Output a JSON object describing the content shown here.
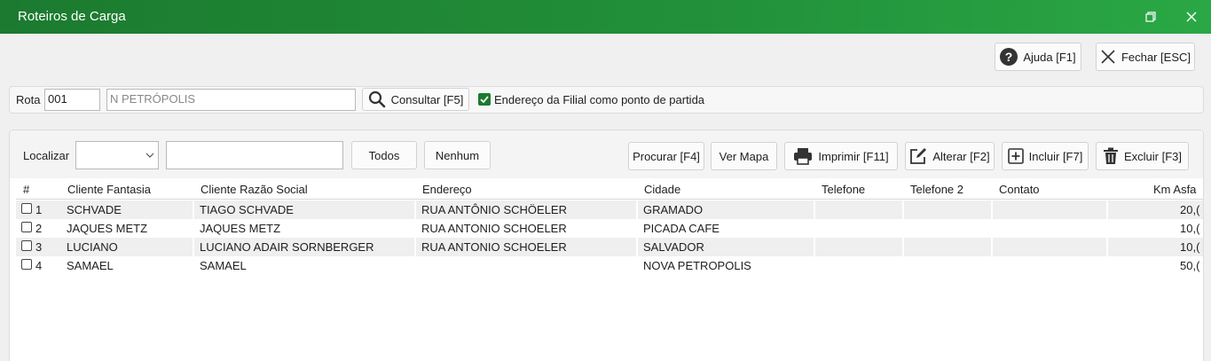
{
  "window": {
    "title": "Roteiros de Carga",
    "restore_icon": "restore-icon",
    "close_icon": "close-icon"
  },
  "topbar": {
    "help_label": "Ajuda [F1]",
    "close_label": "Fechar [ESC]"
  },
  "rota": {
    "label": "Rota",
    "code": "001",
    "name": "N PETRÓPOLIS",
    "consult_label": "Consultar [F5]",
    "filial_checked": true,
    "filial_label": "Endereço da Filial como ponto de partida"
  },
  "toolbar": {
    "locate_label": "Localizar",
    "locate_select_value": "",
    "locate_input_value": "",
    "all_label": "Todos",
    "none_label": "Nenhum",
    "search_label": "Procurar [F4]",
    "map_label": "Ver Mapa",
    "print_label": "Imprimir [F11]",
    "edit_label": "Alterar [F2]",
    "add_label": "Incluir [F7]",
    "delete_label": "Excluir [F3]"
  },
  "table": {
    "columns": [
      "#",
      "Cliente Fantasia",
      "Cliente Razão Social",
      "Endereço",
      "Cidade",
      "Telefone",
      "Telefone 2",
      "Contato",
      "Km Asfa"
    ],
    "rows": [
      {
        "num": "1",
        "fantasia": "SCHVADE",
        "razao": "TIAGO SCHVADE",
        "endereco": "RUA ANTÔNIO SCHÖELER",
        "cidade": "GRAMADO",
        "telefone": "",
        "telefone2": "",
        "contato": "",
        "km": "20,("
      },
      {
        "num": "2",
        "fantasia": "JAQUES METZ",
        "razao": "JAQUES METZ",
        "endereco": "RUA ANTONIO SCHOELER",
        "cidade": "PICADA CAFE",
        "telefone": "",
        "telefone2": "",
        "contato": "",
        "km": "10,("
      },
      {
        "num": "3",
        "fantasia": "LUCIANO",
        "razao": "LUCIANO ADAIR SORNBERGER",
        "endereco": "RUA ANTONIO SCHOELER",
        "cidade": "SALVADOR",
        "telefone": "",
        "telefone2": "",
        "contato": "",
        "km": "10,("
      },
      {
        "num": "4",
        "fantasia": "SAMAEL",
        "razao": "SAMAEL",
        "endereco": "",
        "cidade": "NOVA PETROPOLIS",
        "telefone": "",
        "telefone2": "",
        "contato": "",
        "km": "50,("
      }
    ]
  },
  "colors": {
    "title_bar": "#1b7a2f",
    "accent": "#2aa845"
  }
}
